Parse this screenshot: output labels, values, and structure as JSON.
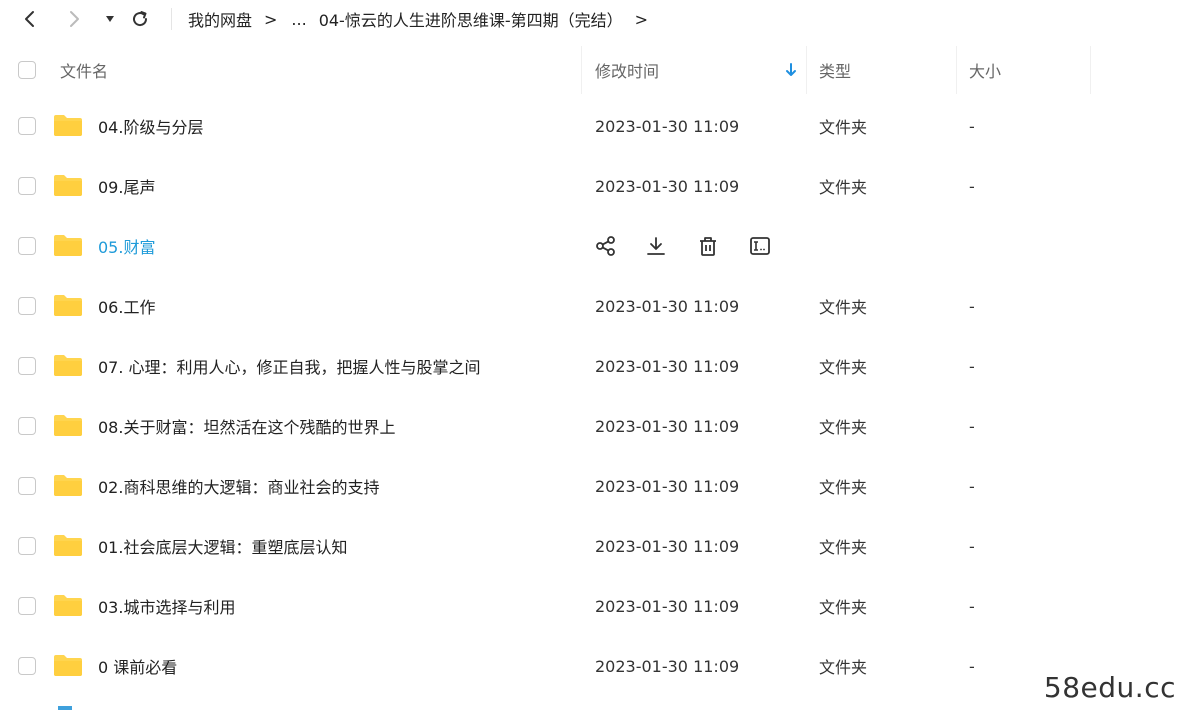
{
  "toolbar": {
    "back_icon": "chevron-left-icon",
    "forward_icon": "chevron-right-icon",
    "history_icon": "caret-down-icon",
    "refresh_icon": "refresh-icon",
    "breadcrumb": {
      "root": "我的网盘",
      "separator": ">",
      "ellipsis": "...",
      "current": "04-惊云的人生进阶思维课-第四期（完结）"
    }
  },
  "header": {
    "name": "文件名",
    "modified": "修改时间",
    "type": "类型",
    "size": "大小",
    "sort_icon": "arrow-down-icon",
    "sort_color": "#1f8fe0"
  },
  "accent": "#1f9bd9",
  "folder_color": "#ffd54f",
  "rows": [
    {
      "name": "04.阶级与分层",
      "date": "2023-01-30 11:09",
      "type": "文件夹",
      "size": "-"
    },
    {
      "name": "09.尾声",
      "date": "2023-01-30 11:09",
      "type": "文件夹",
      "size": "-"
    },
    {
      "name": "05.财富",
      "hover": true,
      "actions": [
        "share-icon",
        "download-icon",
        "delete-icon",
        "rename-icon"
      ]
    },
    {
      "name": "06.工作",
      "date": "2023-01-30 11:09",
      "type": "文件夹",
      "size": "-"
    },
    {
      "name": "07. 心理：利用人心，修正自我，把握人性与股掌之间",
      "date": "2023-01-30 11:09",
      "type": "文件夹",
      "size": "-"
    },
    {
      "name": "08.关于财富：坦然活在这个残酷的世界上",
      "date": "2023-01-30 11:09",
      "type": "文件夹",
      "size": "-"
    },
    {
      "name": "02.商科思维的大逻辑：商业社会的支持",
      "date": "2023-01-30 11:09",
      "type": "文件夹",
      "size": "-"
    },
    {
      "name": "01.社会底层大逻辑：重塑底层认知",
      "date": "2023-01-30 11:09",
      "type": "文件夹",
      "size": "-"
    },
    {
      "name": "03.城市选择与利用",
      "date": "2023-01-30 11:09",
      "type": "文件夹",
      "size": "-"
    },
    {
      "name": "0 课前必看",
      "date": "2023-01-30 11:09",
      "type": "文件夹",
      "size": "-"
    }
  ],
  "watermark": "58edu.cc"
}
